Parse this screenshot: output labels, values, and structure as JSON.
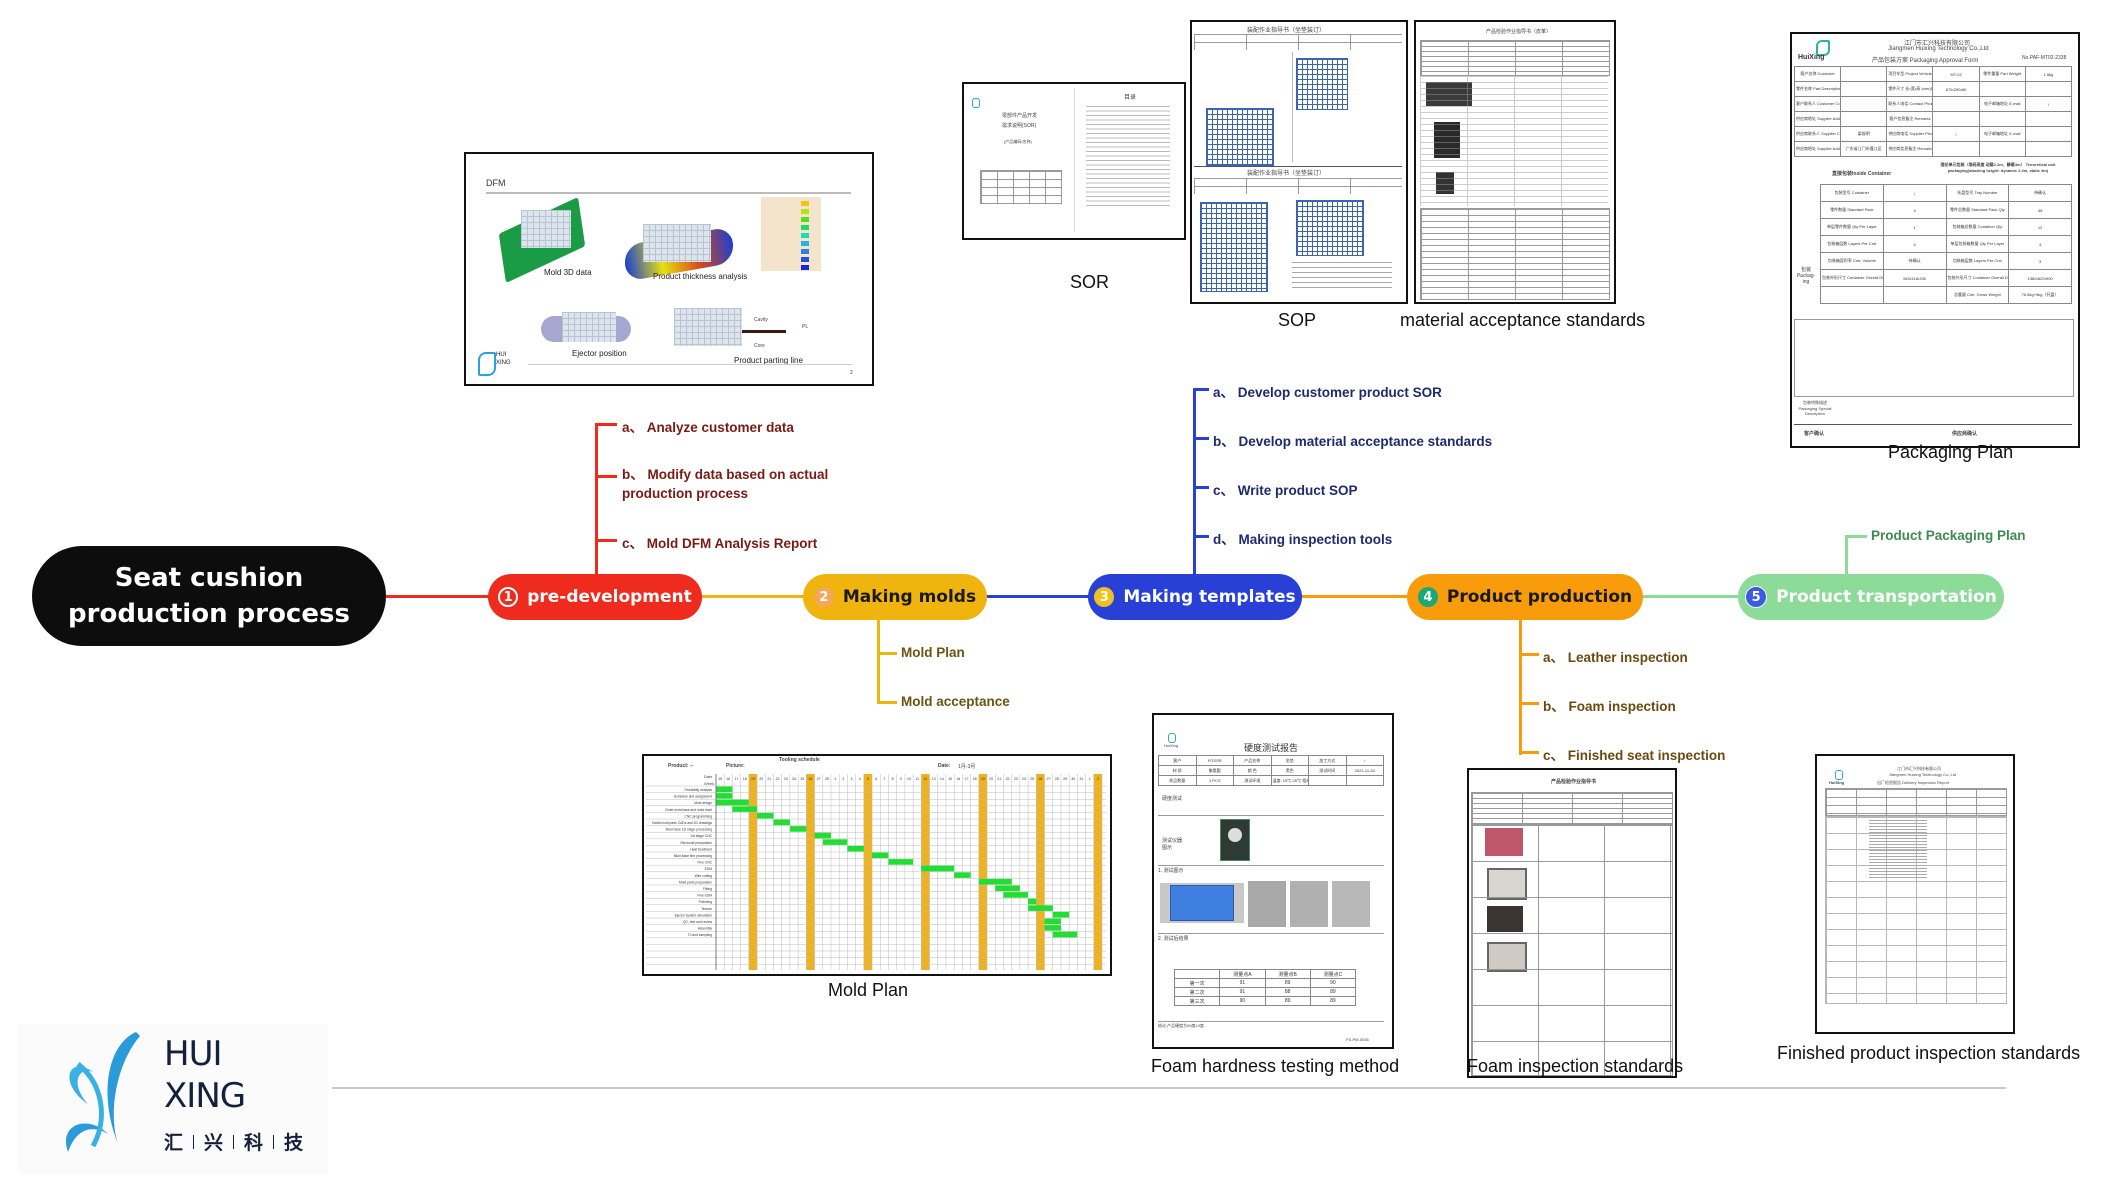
{
  "root": {
    "title_line1": "Seat cushion",
    "title_line2": "production process"
  },
  "colors": {
    "stage1": "#ee2b1c",
    "stage2": "#f0b40f",
    "stage3": "#2840d6",
    "stage4": "#f89c0b",
    "stage5": "#8cdb98",
    "root": "#0d0d0d"
  },
  "stages": [
    {
      "num": "1",
      "label": "pre-development",
      "items": [
        {
          "prefix": "a、",
          "text": "Analyze customer data"
        },
        {
          "prefix": "b、",
          "text": "Modify data based on actual production process"
        },
        {
          "prefix": "c、",
          "text": "Mold DFM Analysis Report"
        }
      ]
    },
    {
      "num": "2",
      "label": "Making molds",
      "items": [
        {
          "prefix": "",
          "text": "Mold Plan"
        },
        {
          "prefix": "",
          "text": "Mold acceptance"
        }
      ]
    },
    {
      "num": "3",
      "label": "Making templates",
      "items": [
        {
          "prefix": "a、",
          "text": "Develop customer product SOR"
        },
        {
          "prefix": "b、",
          "text": "Develop material acceptance standards"
        },
        {
          "prefix": "c、",
          "text": "Write product SOP"
        },
        {
          "prefix": "d、",
          "text": "Making inspection tools"
        }
      ]
    },
    {
      "num": "4",
      "label": "Product production",
      "items": [
        {
          "prefix": "a、",
          "text": "Leather inspection"
        },
        {
          "prefix": "b、",
          "text": "Foam inspection"
        },
        {
          "prefix": "c、",
          "text": "Finished seat inspection"
        }
      ]
    },
    {
      "num": "5",
      "label": "Product transportation",
      "items": [
        {
          "prefix": "",
          "text": "Product Packaging Plan"
        }
      ]
    }
  ],
  "documents": {
    "dfm": {
      "header": "DFM",
      "labels": [
        "Mold 3D data",
        "Product thickness analysis",
        "Ejector position",
        "Product parting line"
      ],
      "annotations": [
        "Cavity",
        "Core",
        "PL"
      ],
      "page": "2"
    },
    "sor": {
      "caption": "SOR",
      "toc_title": "目录",
      "cover_line1": "零部件产品开发",
      "cover_line2": "需求说明(SOR)",
      "cover_line3": "(产品编码/名称)"
    },
    "sop": {
      "caption": "SOP",
      "title1": "装配作业指导书（坐垫装订）",
      "title2": "装配作业指导书（坐垫装订）"
    },
    "material": {
      "caption": "material acceptance standards",
      "title": "产品检验作业指导书（皮革）"
    },
    "packaging": {
      "caption": "Packaging Plan",
      "company_cn": "江门市汇兴科技有限公司",
      "company_en": "Jiangmen Huixing Technology Co.,Ltd",
      "form_title": "产品包装方案 Packaging Approval Form",
      "form_no": "No.PAF-MT02-2338",
      "logo_text": "HuiXing",
      "rows": [
        [
          "客户名称 Customer",
          "",
          "项目车型 Project Vehicle",
          "MT-02",
          "零件重量 Part Weight",
          "1.5kg"
        ],
        [
          "零件名称 Part Description",
          "",
          "零件尺寸 长•宽•高 (mm)Dimensions L•W•H",
          "670•290•80",
          "",
          ""
        ],
        [
          "客户联系人 Customer Contact",
          "",
          "联系人电话 Contact Phone",
          "",
          "电子邮箱地址 E-mail",
          "/"
        ],
        [
          "供应商地址 Supplier Address",
          "",
          "客户信息备注 Remarks",
          "",
          "",
          ""
        ],
        [
          "供应商联系人 Supplier Contact",
          "梁振明",
          "供应商电话 Supplier Phone",
          "/",
          "电子邮箱地址 E-mail",
          ""
        ],
        [
          "供应商地址 Supplier Address",
          "广东省江门市蓬江区",
          "供应商信息备注 Remarks",
          "",
          "",
          ""
        ]
      ],
      "section_inside": "直接包装Inside Container",
      "section_theoretical": "理论单元包装（堆码高度 动载2.2m、静载4m） Theoretical unit packaging(stacking height: dynamic 2.2m, static 4m)",
      "packing_label": "包装 Packag-ing",
      "inner_rows": [
        [
          "包装型号 Container",
          "/",
          "托盘型号 Tray Number",
          "待确认"
        ],
        [
          "零件数量 Standard Pack",
          "4",
          "零件总数量 Standard Pack Qty",
          "48"
        ],
        [
          "单层零件数量 Qty Per Layer",
          "1",
          "包装箱总数量 Container Qty",
          "12"
        ],
        [
          "包装箱层数 Layers Per Cntr",
          "4",
          "单层包装箱数量 Qty Per Layer",
          "4"
        ],
        [
          "包装箱容积率 Cntr. Volume",
          "待确认",
          "包装箱层数 Layers Per Cntr",
          "3"
        ],
        [
          "包装外形尺寸 Container Overall Dimensions L•W•H",
          "940•318•330",
          "包装外形尺寸 Container Overall Dimensions L•W•H",
          "1380•620•900"
        ],
        [
          "",
          "",
          "总重量 Cntr. Gross Weight",
          "76.8kg+5kg（托盘）"
        ]
      ],
      "special_label": "包装特殊描述 Packaging Special Description",
      "customer_confirm": "客户确认",
      "supplier_confirm": "供应商确认"
    },
    "mold_plan": {
      "caption": "Mold Plan",
      "title": "Tooling schedule",
      "product_label": "Product: --",
      "picture_label": "Picture:",
      "date_label": "Date:",
      "date_value": "1月-3月",
      "row_label_date": "Date",
      "row_label_week": "Week",
      "tasks": [
        "Feasibility analysis",
        "Schedule and assignment",
        "Mold design",
        "Order mold base and mold steel",
        "CNC programming",
        "Detail mold parts CADs and 2D drawings",
        "Mold base 1st stage processing",
        "1st stage CNC",
        "Electrode preparation",
        "Heat treatment",
        "Mold base fine processing",
        "Fine CNC",
        "EDM",
        "Wire cutting",
        "Mold parts preparation",
        "Fitting",
        "Fine EDM",
        "Polishing",
        "Texture",
        "Ejector system simulation",
        "QC, test and review",
        "Assembly",
        "T0 and sampling"
      ],
      "days": [
        "15",
        "16",
        "17",
        "18",
        "19",
        "20",
        "21",
        "22",
        "23",
        "24",
        "25",
        "26",
        "27",
        "28",
        "1",
        "2",
        "3",
        "4",
        "5",
        "6",
        "7",
        "8",
        "9",
        "10",
        "11",
        "12",
        "13",
        "14",
        "15",
        "16",
        "17",
        "18",
        "19",
        "20",
        "21",
        "22",
        "23",
        "24",
        "25",
        "26",
        "27",
        "28",
        "29",
        "30",
        "31",
        "1",
        "2"
      ],
      "task_spans": [
        [
          0,
          1
        ],
        [
          0,
          1
        ],
        [
          0,
          3
        ],
        [
          2,
          4
        ],
        [
          5,
          6
        ],
        [
          7,
          8
        ],
        [
          9,
          10
        ],
        [
          12,
          13
        ],
        [
          13,
          15
        ],
        [
          16,
          17
        ],
        [
          19,
          20
        ],
        [
          21,
          23
        ],
        [
          25,
          28
        ],
        [
          29,
          30
        ],
        [
          32,
          35
        ],
        [
          34,
          36
        ],
        [
          35,
          37
        ],
        [
          38,
          38
        ],
        [
          38,
          40
        ],
        [
          41,
          42
        ],
        [
          40,
          41
        ],
        [
          40,
          41
        ],
        [
          41,
          43
        ]
      ],
      "sunday_indices": [
        4,
        11,
        18,
        25,
        32,
        39,
        46
      ]
    },
    "foam_hardness": {
      "caption": "Foam hardness testing method",
      "title": "硬度测试报告",
      "logo_text": "HuiXing",
      "header_rows": [
        [
          "客户",
          "FOSSR",
          "产品名称",
          "坐垫",
          "加工方式",
          "/"
        ],
        [
          "材 质",
          "聚氨酯",
          "颜 色",
          "黑色",
          "测试时间",
          "2021-11-30"
        ],
        [
          "样品数量",
          "1 PCS",
          "测试环境",
          "温度: 15℃-25℃  相对湿度: 40%-70%",
          "",
          ""
        ]
      ],
      "test_label": "硬度测试",
      "instrument_label": "测试仪器图示",
      "section1": "1. 测试图示",
      "section2": "2. 测试后结果",
      "results_header": [
        "",
        "测量点A",
        "测量点B",
        "测量点C"
      ],
      "results": [
        [
          "第一次",
          "91",
          "89",
          "90"
        ],
        [
          "第二次",
          "91",
          "88",
          "89"
        ],
        [
          "第三次",
          "90",
          "89",
          "89"
        ]
      ],
      "conclusion": "结论:产品硬度为90度±3度",
      "footer_tester": "测试员:",
      "footer_reviewer": "审核:",
      "footer_approver": "批准:",
      "doc_no": "FS-PM-0036"
    },
    "foam_inspection": {
      "caption": "Foam inspection standards",
      "title": "产品检验作业指导书"
    },
    "finished_inspection": {
      "caption": "Finished product inspection standards",
      "company_cn": "江门市汇兴科技有限公司",
      "company_en": "Jiangmen Huixing Technology Co.,Ltd",
      "title": "出厂检验报告 Delivery Inspection Report",
      "logo_text": "HuiXing"
    }
  },
  "logo": {
    "line1": "HUI",
    "line2": "XING",
    "cn": [
      "汇",
      "兴",
      "科",
      "技"
    ]
  }
}
